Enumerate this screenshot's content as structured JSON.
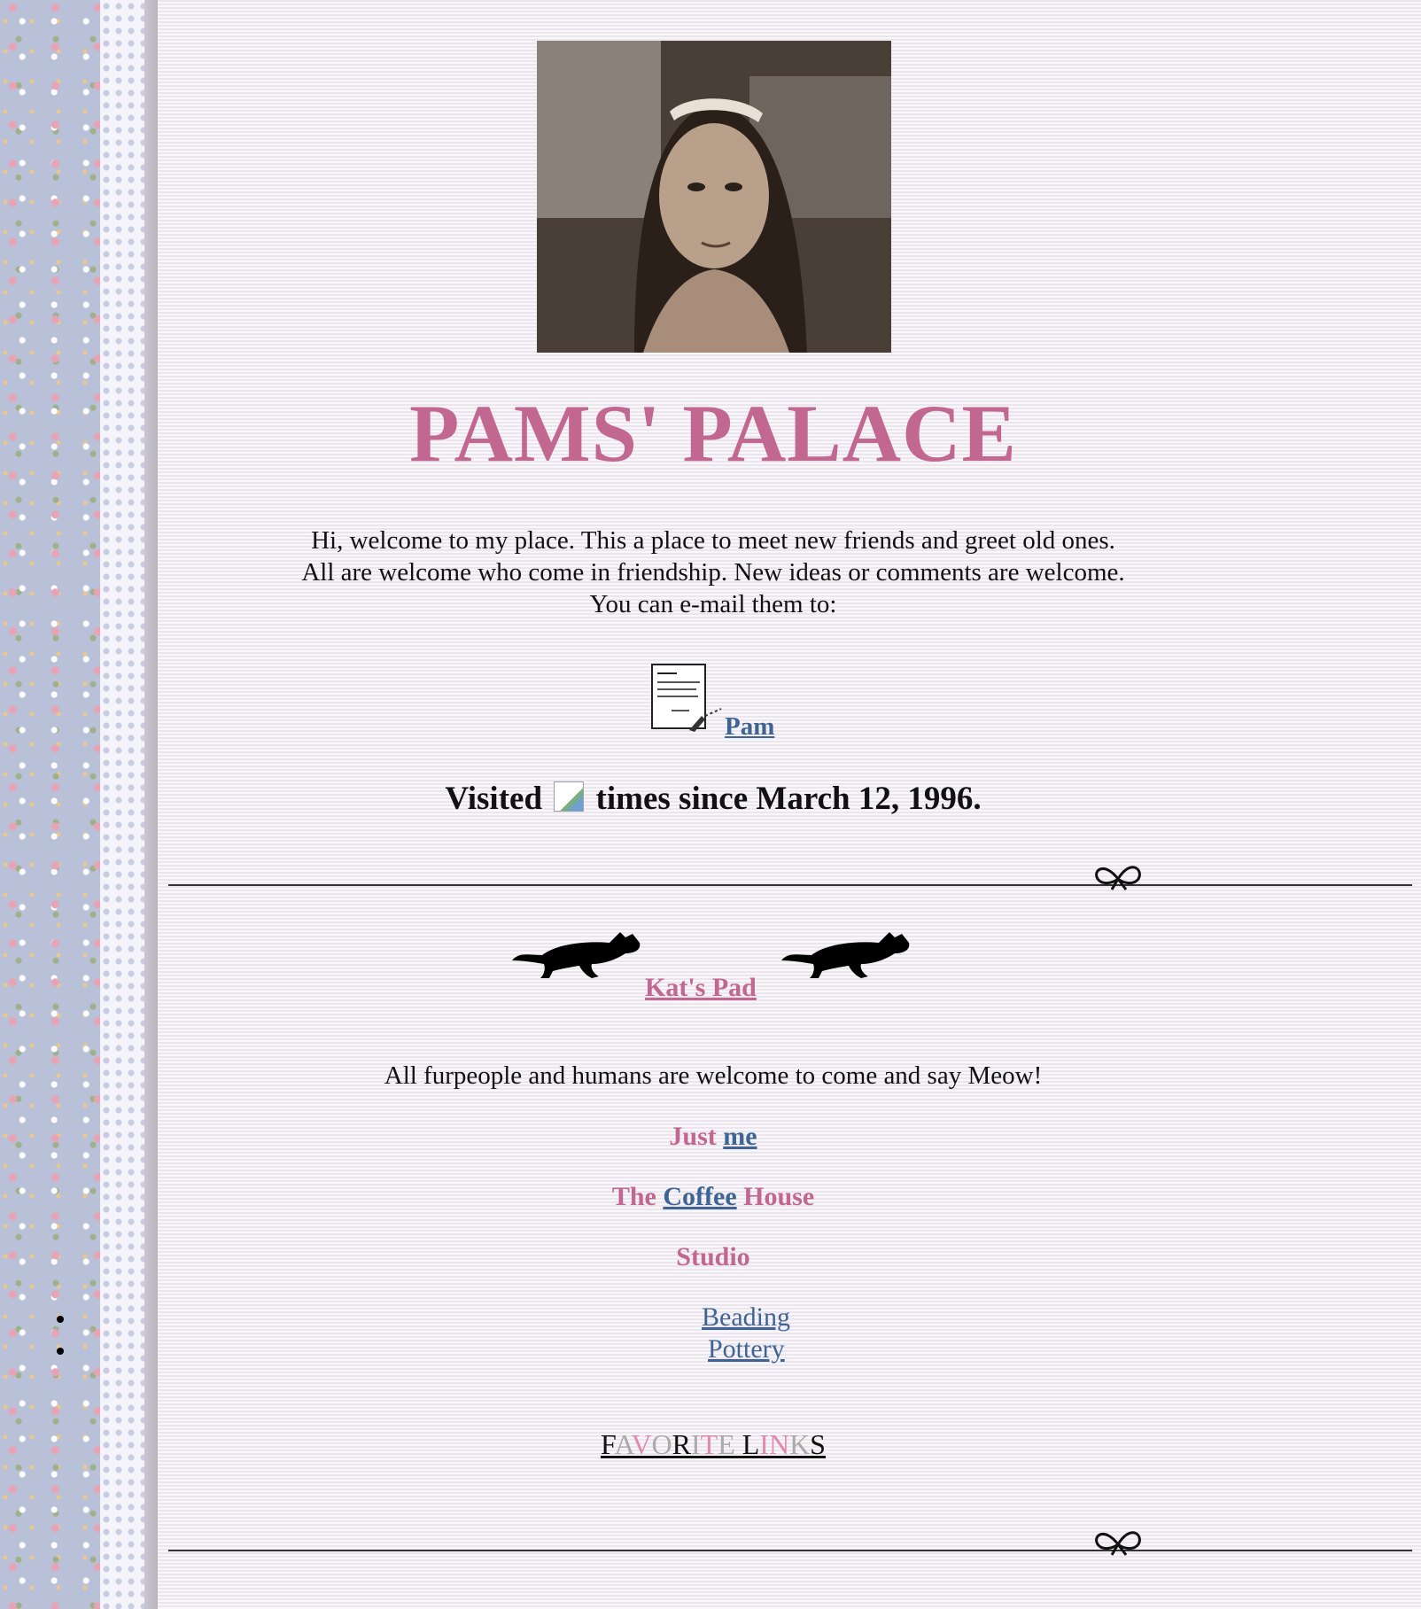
{
  "page": {
    "title": "PAMS' PALACE",
    "intro_lines": [
      "Hi, welcome to my place. This a place to meet new friends and greet old ones.",
      "All are welcome who come in friendship. New ideas or comments are welcome.",
      "You can e-mail them to:"
    ],
    "email_link": "Pam",
    "visited": {
      "before": "Visited",
      "after": "times since March 12, 1996."
    }
  },
  "cats": {
    "link": "Kat's Pad",
    "welcome": "All furpeople and humans are welcome to come and say Meow!"
  },
  "menu": {
    "just_prefix": "Just",
    "just_link": "me",
    "coffee_prefix": "The",
    "coffee_link": "Coffee",
    "coffee_suffix": "House",
    "studio_label": "Studio",
    "studio_items": [
      "Beading",
      "Pottery"
    ]
  },
  "favorites": {
    "letters": [
      "F",
      "A",
      "V",
      "O",
      "R",
      "I",
      "T",
      "E",
      " ",
      "L",
      "I",
      "N",
      "K",
      "S"
    ],
    "colors": [
      "#111111",
      "#aaaaaa",
      "#e08ab0",
      "#aaaaaa",
      "#111111",
      "#aaaaaa",
      "#e08ab0",
      "#aaaaaa",
      "#111111",
      "#111111",
      "#e08ab0",
      "#e08ab0",
      "#aaaaaa",
      "#111111"
    ]
  },
  "colors": {
    "title_pink": "#c2678f",
    "link_blue": "#3e6493",
    "background": "#f3eef4"
  }
}
